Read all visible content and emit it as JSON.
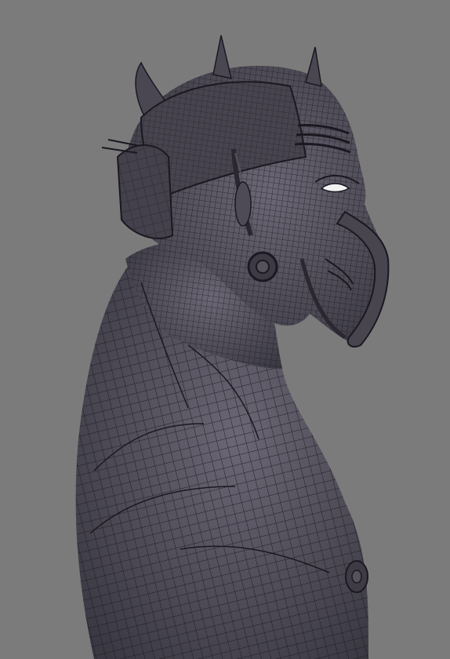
{
  "viewport": {
    "background_color": "#7b7b7b",
    "mesh_fill_color": "#4a4753",
    "mesh_wire_color": "#1a1820",
    "highlight_color": "#6b6775"
  }
}
